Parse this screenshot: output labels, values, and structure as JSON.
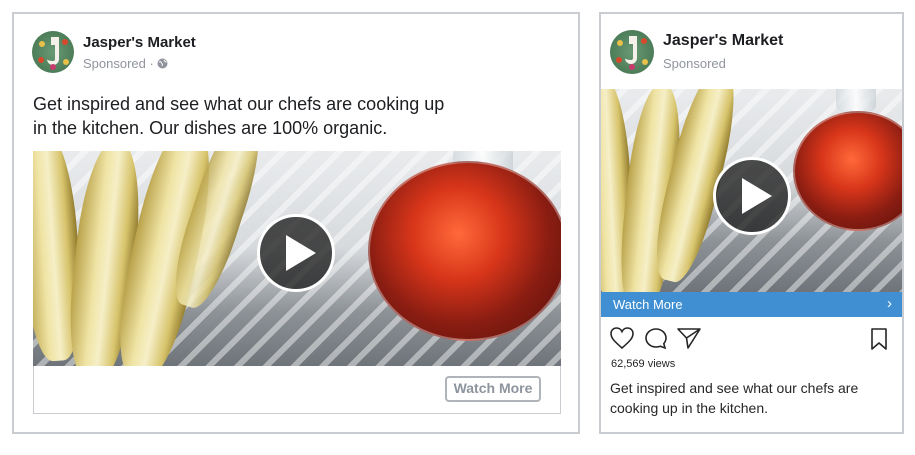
{
  "facebook_ad": {
    "page_name": "Jasper's Market",
    "sponsored": "Sponsored",
    "sponsored_separator": "·",
    "post_text_line1": "Get inspired and see what our chefs are cooking up",
    "post_text_line2": "in the kitchen. Our dishes are 100% organic.",
    "cta_label": "Watch More"
  },
  "instagram_ad": {
    "account_name": "Jasper's Market",
    "sponsored": "Sponsored",
    "cta_label": "Watch More",
    "cta_chevron": "›",
    "views": "62,569 views",
    "caption_line1": "Get inspired and see what our chefs are",
    "caption_line2": "cooking up in the kitchen."
  },
  "icons": [
    "avatar-logo",
    "globe-icon",
    "play-icon",
    "heart-icon",
    "comment-icon",
    "share-icon",
    "bookmark-icon",
    "chevron-right-icon"
  ],
  "colors": {
    "ig_cta_bar": "#3f8fd2",
    "border": "#c9ccd1",
    "muted_text": "#90949c"
  }
}
